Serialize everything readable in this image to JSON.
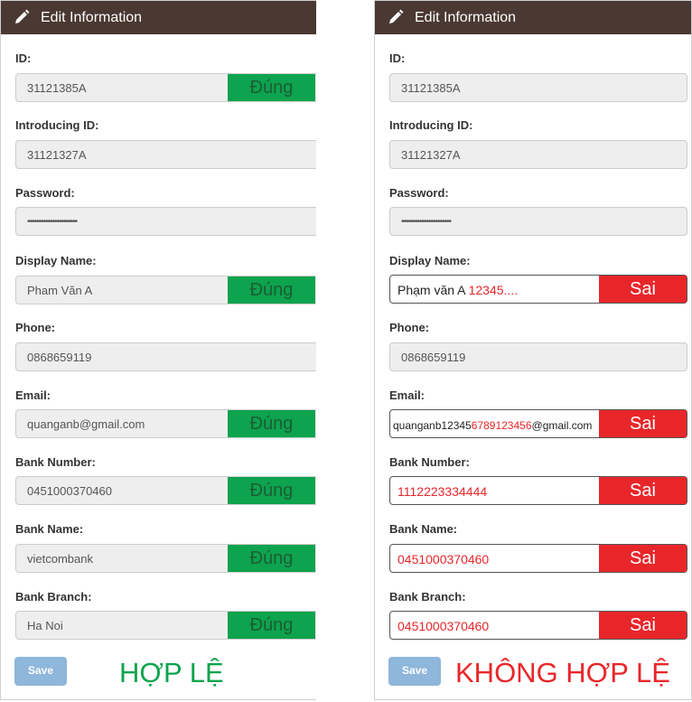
{
  "colors": {
    "header_bg": "#4a3832",
    "valid_green": "#0ea34e",
    "invalid_red": "#e8262a",
    "save_button": "#8fb6db"
  },
  "left": {
    "title": "Edit Information",
    "icon": "pencil-icon",
    "labels": {
      "id": "ID:",
      "introducing_id": "Introducing ID:",
      "password": "Password:",
      "display_name": "Display Name:",
      "phone": "Phone:",
      "email": "Email:",
      "bank_number": "Bank Number:",
      "bank_name": "Bank Name:",
      "bank_branch": "Bank Branch:"
    },
    "values": {
      "id": "31121385A",
      "introducing_id": "31121327A",
      "password": "••••••••••••••••••••••",
      "display_name": "Pham Văn A",
      "phone": "0868659119",
      "email": "quanganb@gmail.com",
      "bank_number": "0451000370460",
      "bank_name": "vietcombank",
      "bank_branch": "Ha Noi"
    },
    "badge_text": "Đúng",
    "save_label": "Save",
    "verdict": "HỢP LỆ"
  },
  "right": {
    "title": "Edit Information",
    "icon": "pencil-icon",
    "labels": {
      "id": "ID:",
      "introducing_id": "Introducing ID:",
      "password": "Password:",
      "display_name": "Display Name:",
      "phone": "Phone:",
      "email": "Email:",
      "bank_number": "Bank Number:",
      "bank_name": "Bank Name:",
      "bank_branch": "Bank Branch:"
    },
    "values": {
      "id": "31121385A",
      "introducing_id": "31121327A",
      "password": "••••••••••••••••••••••",
      "display_name_valid": "Phạm văn A ",
      "display_name_error": "12345....",
      "phone": "0868659119",
      "email_prefix": "quanganb12345",
      "email_error": "6789123456",
      "email_suffix": "@gmail.com",
      "bank_number": "1112223334444",
      "bank_name": "0451000370460",
      "bank_branch": "0451000370460"
    },
    "badge_text": "Sai",
    "save_label": "Save",
    "verdict": "KHÔNG HỢP LỆ"
  }
}
